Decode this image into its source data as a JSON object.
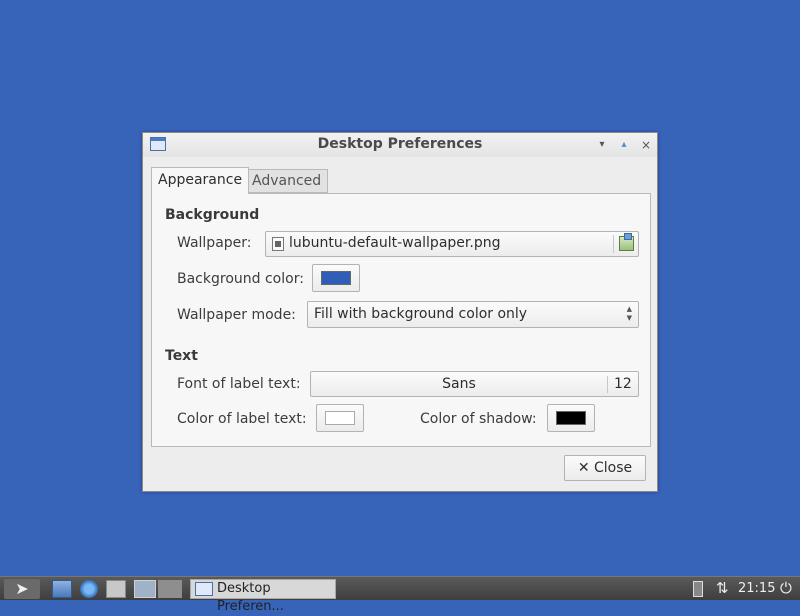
{
  "window": {
    "title": "Desktop Preferences",
    "controls": {
      "minimize": "▾",
      "maximize": "▴",
      "close": "×"
    }
  },
  "tabs": [
    {
      "label": "Appearance",
      "active": true
    },
    {
      "label": "Advanced",
      "active": false
    }
  ],
  "background": {
    "section_title": "Background",
    "wallpaper_label": "Wallpaper:",
    "wallpaper_file": "lubuntu-default-wallpaper.png",
    "bg_color_label": "Background color:",
    "bg_color": "#2f5db8",
    "mode_label": "Wallpaper mode:",
    "mode_value": "Fill with background color only"
  },
  "text": {
    "section_title": "Text",
    "font_label": "Font of label text:",
    "font_name": "Sans",
    "font_size": "12",
    "label_color_label": "Color of label text:",
    "label_color": "#ffffff",
    "shadow_label": "Color of shadow:",
    "shadow_color": "#000000"
  },
  "buttons": {
    "close": "✕ Close"
  },
  "taskbar": {
    "task_label": "Desktop Preferen...",
    "clock": "21:15",
    "icons": [
      "start-menu-icon",
      "file-manager-icon",
      "browser-icon",
      "show-desktop-icon",
      "workspace-1",
      "workspace-2",
      "battery-icon",
      "network-icon",
      "power-icon"
    ]
  },
  "colors": {
    "desktop": "#3763b9",
    "accent": "#4a7bc8"
  }
}
